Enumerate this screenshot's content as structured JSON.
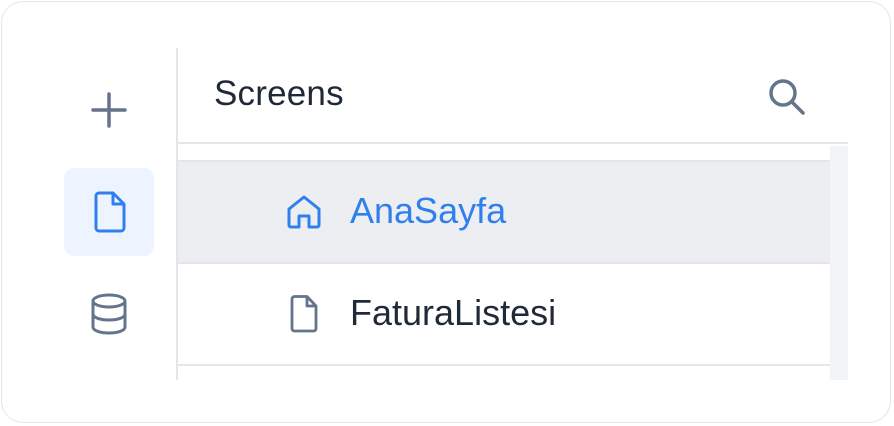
{
  "rail": {
    "items": [
      {
        "icon": "plus-icon",
        "active": false
      },
      {
        "icon": "file-icon",
        "active": true
      },
      {
        "icon": "database-icon",
        "active": false
      }
    ]
  },
  "panel": {
    "title": "Screens",
    "search_icon": "search-icon"
  },
  "screens": [
    {
      "label": "AnaSayfa",
      "icon": "home-icon",
      "selected": true
    },
    {
      "label": "FaturaListesi",
      "icon": "file-icon",
      "selected": false
    }
  ],
  "colors": {
    "accent": "#2f80ed",
    "selected_row_bg": "#eceef1",
    "active_rail_bg": "#eef4ff",
    "text": "#1f2937",
    "icon_gray": "#64748b"
  }
}
